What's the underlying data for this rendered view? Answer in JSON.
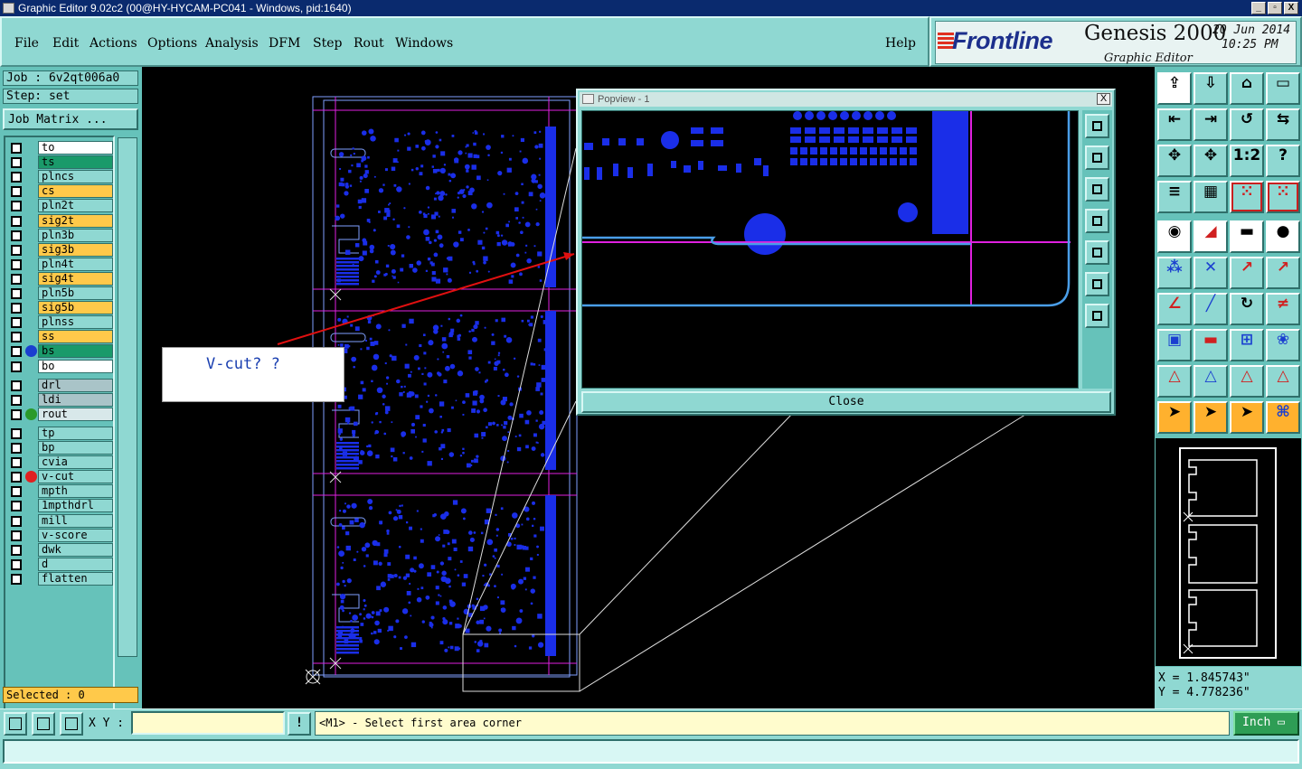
{
  "window": {
    "title": "Graphic Editor 9.02c2 (00@HY-HYCAM-PC041 - Windows, pid:1640)",
    "buttons": [
      "_",
      "▫",
      "X"
    ]
  },
  "menu": {
    "items": [
      {
        "label": "File"
      },
      {
        "label": "Edit"
      },
      {
        "label": "Actions"
      },
      {
        "label": "Options"
      },
      {
        "label": "Analysis"
      },
      {
        "label": "DFM"
      },
      {
        "label": "Step"
      },
      {
        "label": "Rout"
      },
      {
        "label": "Windows"
      }
    ],
    "help": "Help"
  },
  "brand": {
    "logo": "Frontline",
    "product": "Genesis 2000",
    "subtitle": "Graphic Editor",
    "date": "20 Jun 2014",
    "time": "10:25 PM"
  },
  "job": {
    "job_line": "Job : 6v2qt006a0",
    "step_line": "Step: set",
    "matrix_button": "Job Matrix ...",
    "selected": "Selected : 0"
  },
  "layers": [
    {
      "name": "to",
      "color": "#ffffff",
      "group": 0,
      "indicator": ""
    },
    {
      "name": "ts",
      "color": "#1a9a6a",
      "group": 0,
      "indicator": ""
    },
    {
      "name": "plncs",
      "color": "#8fd8d2",
      "group": 0,
      "indicator": ""
    },
    {
      "name": "cs",
      "color": "#ffc94a",
      "group": 0,
      "indicator": ""
    },
    {
      "name": "pln2t",
      "color": "#8fd8d2",
      "group": 0,
      "indicator": ""
    },
    {
      "name": "sig2t",
      "color": "#ffc94a",
      "group": 0,
      "indicator": ""
    },
    {
      "name": "pln3b",
      "color": "#8fd8d2",
      "group": 0,
      "indicator": ""
    },
    {
      "name": "sig3b",
      "color": "#ffc94a",
      "group": 0,
      "indicator": ""
    },
    {
      "name": "pln4t",
      "color": "#8fd8d2",
      "group": 0,
      "indicator": ""
    },
    {
      "name": "sig4t",
      "color": "#ffc94a",
      "group": 0,
      "indicator": ""
    },
    {
      "name": "pln5b",
      "color": "#8fd8d2",
      "group": 0,
      "indicator": ""
    },
    {
      "name": "sig5b",
      "color": "#ffc94a",
      "group": 0,
      "indicator": ""
    },
    {
      "name": "plnss",
      "color": "#8fd8d2",
      "group": 0,
      "indicator": ""
    },
    {
      "name": "ss",
      "color": "#ffc94a",
      "group": 0,
      "indicator": ""
    },
    {
      "name": "bs",
      "color": "#1a9a6a",
      "group": 0,
      "indicator": "#1a3fd0"
    },
    {
      "name": "bo",
      "color": "#ffffff",
      "group": 0,
      "indicator": ""
    },
    {
      "name": "drl",
      "color": "#a9c4c8",
      "group": 1,
      "indicator": ""
    },
    {
      "name": "ldi",
      "color": "#a9c4c8",
      "group": 1,
      "indicator": ""
    },
    {
      "name": "rout",
      "color": "#d8e8ea",
      "group": 1,
      "indicator": "#2a9a2a"
    },
    {
      "name": "tp",
      "color": "#8fd8d2",
      "group": 2,
      "indicator": ""
    },
    {
      "name": "bp",
      "color": "#8fd8d2",
      "group": 2,
      "indicator": ""
    },
    {
      "name": "cvia",
      "color": "#8fd8d2",
      "group": 2,
      "indicator": ""
    },
    {
      "name": "v-cut",
      "color": "#8fd8d2",
      "group": 2,
      "indicator": "#e02020"
    },
    {
      "name": "mpth",
      "color": "#8fd8d2",
      "group": 2,
      "indicator": ""
    },
    {
      "name": "1mpthdrl",
      "color": "#8fd8d2",
      "group": 2,
      "indicator": ""
    },
    {
      "name": "mill",
      "color": "#8fd8d2",
      "group": 2,
      "indicator": ""
    },
    {
      "name": "v-score",
      "color": "#8fd8d2",
      "group": 2,
      "indicator": ""
    },
    {
      "name": "dwk",
      "color": "#8fd8d2",
      "group": 2,
      "indicator": ""
    },
    {
      "name": "d",
      "color": "#8fd8d2",
      "group": 2,
      "indicator": ""
    },
    {
      "name": "flatten",
      "color": "#8fd8d2",
      "group": 2,
      "indicator": ""
    }
  ],
  "annotation": {
    "text": "V-cut? ?"
  },
  "popview": {
    "title": "Popview - 1",
    "close_x": "X",
    "close_button": "Close",
    "tools": [
      "zoom-fit",
      "pan-up",
      "pan-down",
      "pan-left",
      "pan-right",
      "zoom-in",
      "zoom-out"
    ]
  },
  "coords": {
    "x": "X = 1.845743\"",
    "y": "Y = 4.778236\""
  },
  "bottom": {
    "xy_label": "X Y :",
    "xy_value": "",
    "bang": "!",
    "prompt": "<M1> - Select first area corner",
    "units": "Inch ▭"
  },
  "colors": {
    "panel": "#8fd8d2",
    "panel_dark": "#66c2ba",
    "pcb_blue": "#1a2ee8",
    "outline": "#7fa0ff",
    "magenta": "#e020e0"
  }
}
